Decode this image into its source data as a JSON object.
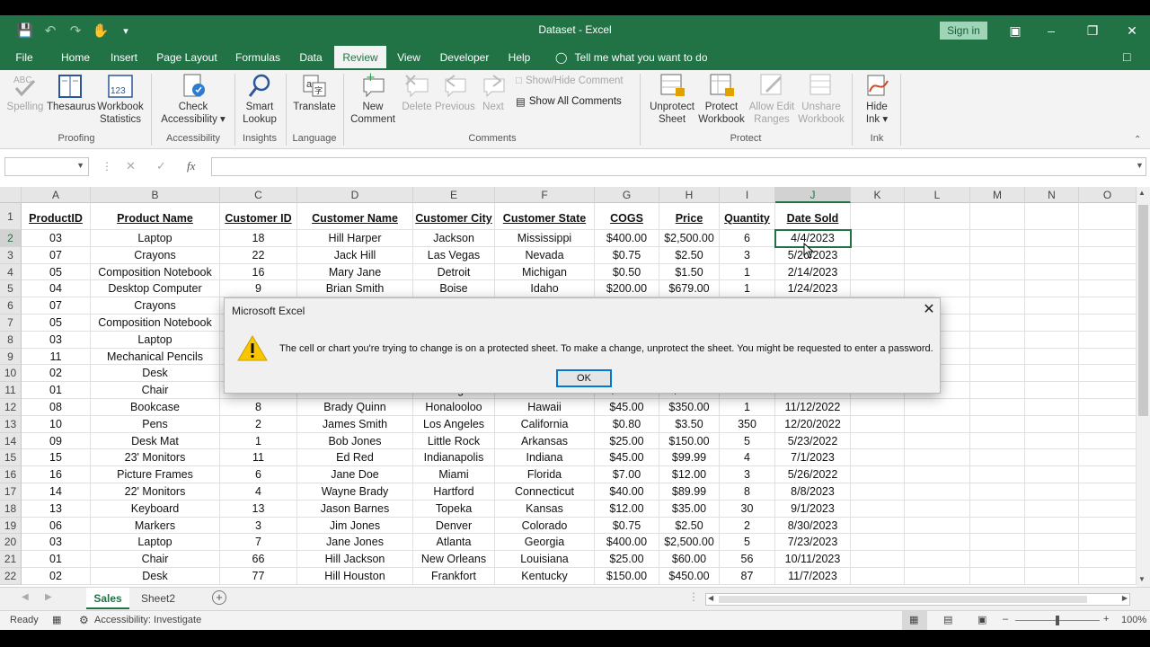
{
  "window": {
    "title": "Dataset  -  Excel",
    "signin_label": "Sign in"
  },
  "menu": {
    "tabs": [
      "File",
      "Home",
      "Insert",
      "Page Layout",
      "Formulas",
      "Data",
      "Review",
      "View",
      "Developer",
      "Help"
    ],
    "active": "Review",
    "tell_me": "Tell me what you want to do"
  },
  "ribbon": {
    "spelling": "Spelling",
    "thesaurus": "Thesaurus",
    "workbook_statistics_1": "Workbook",
    "workbook_statistics_2": "Statistics",
    "proofing": "Proofing",
    "check_accessibility_1": "Check",
    "check_accessibility_2": "Accessibility ▾",
    "accessibility": "Accessibility",
    "smart_lookup_1": "Smart",
    "smart_lookup_2": "Lookup",
    "insights": "Insights",
    "translate": "Translate",
    "language": "Language",
    "new_comment_1": "New",
    "new_comment_2": "Comment",
    "delete": "Delete",
    "previous": "Previous",
    "next": "Next",
    "show_hide_comment": "Show/Hide Comment",
    "show_all_comments": "Show All Comments",
    "comments": "Comments",
    "unprotect_sheet_1": "Unprotect",
    "unprotect_sheet_2": "Sheet",
    "protect_workbook_1": "Protect",
    "protect_workbook_2": "Workbook",
    "allow_edit_ranges_1": "Allow Edit",
    "allow_edit_ranges_2": "Ranges",
    "unshare_workbook_1": "Unshare",
    "unshare_workbook_2": "Workbook",
    "protect": "Protect",
    "hide_ink_1": "Hide",
    "hide_ink_2": "Ink ▾",
    "ink": "Ink"
  },
  "formula_bar": {
    "fx": "fx"
  },
  "grid": {
    "columns": [
      "A",
      "B",
      "C",
      "D",
      "E",
      "F",
      "G",
      "H",
      "I",
      "J",
      "K",
      "L",
      "M",
      "N",
      "O"
    ],
    "selected_column": "J",
    "headers": [
      "ProductID",
      "Product Name",
      "Customer ID",
      "Customer Name",
      "Customer City",
      "Customer State",
      "COGS",
      "Price",
      "Quantity",
      "Date Sold"
    ],
    "rows": [
      [
        "03",
        "Laptop",
        "18",
        "Hill Harper",
        "Jackson",
        "Mississippi",
        "$400.00",
        "$2,500.00",
        "6",
        "4/4/2023"
      ],
      [
        "07",
        "Crayons",
        "22",
        "Jack Hill",
        "Las Vegas",
        "Nevada",
        "$0.75",
        "$2.50",
        "3",
        "5/20/2023"
      ],
      [
        "05",
        "Composition Notebook",
        "16",
        "Mary Jane",
        "Detroit",
        "Michigan",
        "$0.50",
        "$1.50",
        "1",
        "2/14/2023"
      ],
      [
        "04",
        "Desktop Computer",
        "9",
        "Brian Smith",
        "Boise",
        "Idaho",
        "$200.00",
        "$679.00",
        "1",
        "1/24/2023"
      ],
      [
        "07",
        "Crayons",
        "",
        "",
        "",
        "",
        "",
        "",
        "",
        ""
      ],
      [
        "05",
        "Composition Notebook",
        "",
        "",
        "",
        "",
        "",
        "",
        "",
        ""
      ],
      [
        "03",
        "Laptop",
        "",
        "",
        "",
        "",
        "",
        "",
        "",
        ""
      ],
      [
        "11",
        "Mechanical Pencils",
        "",
        "",
        "",
        "",
        "",
        "",
        "",
        ""
      ],
      [
        "02",
        "Desk",
        "",
        "",
        "",
        "",
        "",
        "",
        "",
        ""
      ],
      [
        "01",
        "Chair",
        "27",
        "Michael Parker",
        "Los Angeles",
        "California",
        "$25.00",
        "$60.00",
        "4",
        "2/17/2022"
      ],
      [
        "08",
        "Bookcase",
        "8",
        "Brady Quinn",
        "Honalooloo",
        "Hawaii",
        "$45.00",
        "$350.00",
        "1",
        "11/12/2022"
      ],
      [
        "10",
        "Pens",
        "2",
        "James Smith",
        "Los Angeles",
        "California",
        "$0.80",
        "$3.50",
        "350",
        "12/20/2022"
      ],
      [
        "09",
        "Desk Mat",
        "1",
        "Bob Jones",
        "Little Rock",
        "Arkansas",
        "$25.00",
        "$150.00",
        "5",
        "5/23/2022"
      ],
      [
        "15",
        "23' Monitors",
        "11",
        "Ed Red",
        "Indianapolis",
        "Indiana",
        "$45.00",
        "$99.99",
        "4",
        "7/1/2023"
      ],
      [
        "16",
        "Picture Frames",
        "6",
        "Jane Doe",
        "Miami",
        "Florida",
        "$7.00",
        "$12.00",
        "3",
        "5/26/2022"
      ],
      [
        "14",
        "22' Monitors",
        "4",
        "Wayne Brady",
        "Hartford",
        "Connecticut",
        "$40.00",
        "$89.99",
        "8",
        "8/8/2023"
      ],
      [
        "13",
        "Keyboard",
        "13",
        "Jason Barnes",
        "Topeka",
        "Kansas",
        "$12.00",
        "$35.00",
        "30",
        "9/1/2023"
      ],
      [
        "06",
        "Markers",
        "3",
        "Jim Jones",
        "Denver",
        "Colorado",
        "$0.75",
        "$2.50",
        "2",
        "8/30/2023"
      ],
      [
        "03",
        "Laptop",
        "7",
        "Jane Jones",
        "Atlanta",
        "Georgia",
        "$400.00",
        "$2,500.00",
        "5",
        "7/23/2023"
      ],
      [
        "01",
        "Chair",
        "66",
        "Hill Jackson",
        "New Orleans",
        "Louisiana",
        "$25.00",
        "$60.00",
        "56",
        "10/11/2023"
      ],
      [
        "02",
        "Desk",
        "77",
        "Hill Houston",
        "Frankfort",
        "Kentucky",
        "$150.00",
        "$450.00",
        "87",
        "11/7/2023"
      ]
    ]
  },
  "sheets": {
    "tabs": [
      "Sales",
      "Sheet2"
    ],
    "active": "Sales"
  },
  "status": {
    "ready": "Ready",
    "accessibility": "Accessibility: Investigate",
    "zoom": "100%"
  },
  "dialog": {
    "title": "Microsoft Excel",
    "message": "The cell or chart you're trying to change is on a protected sheet. To make a change, unprotect the sheet. You might be requested to enter a password.",
    "ok_label": "OK"
  }
}
